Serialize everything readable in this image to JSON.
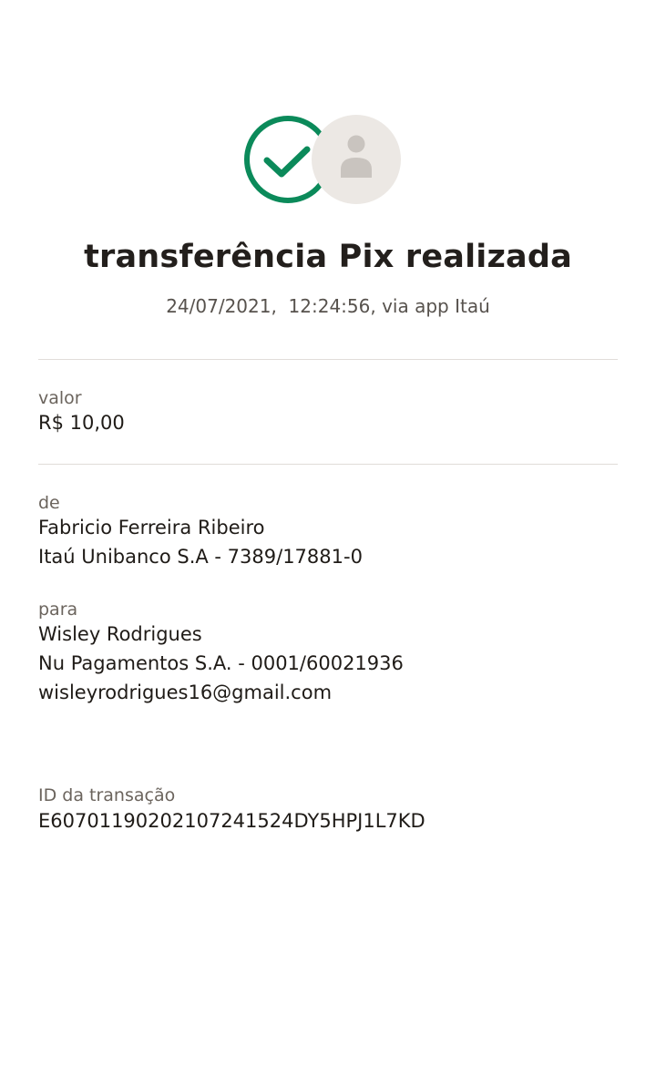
{
  "status": {
    "title": "transferência Pix realizada",
    "subtitle": "24/07/2021,  12:24:56, via app Itaú",
    "success_color": "#0b8a5a",
    "icons": [
      "check-circle-icon",
      "user-avatar-icon"
    ]
  },
  "amount": {
    "label": "valor",
    "value": "R$ 10,00"
  },
  "from": {
    "label": "de",
    "name": "Fabricio Ferreira Ribeiro",
    "bank": "Itaú Unibanco S.A - 7389/17881-0"
  },
  "to": {
    "label": "para",
    "name": "Wisley Rodrigues",
    "bank": "Nu Pagamentos S.A. - 0001/60021936",
    "key": "wisleyrodrigues16@gmail.com"
  },
  "transaction": {
    "label": "ID da transação",
    "id": "E60701190202107241524DY5HPJ1L7KD"
  }
}
